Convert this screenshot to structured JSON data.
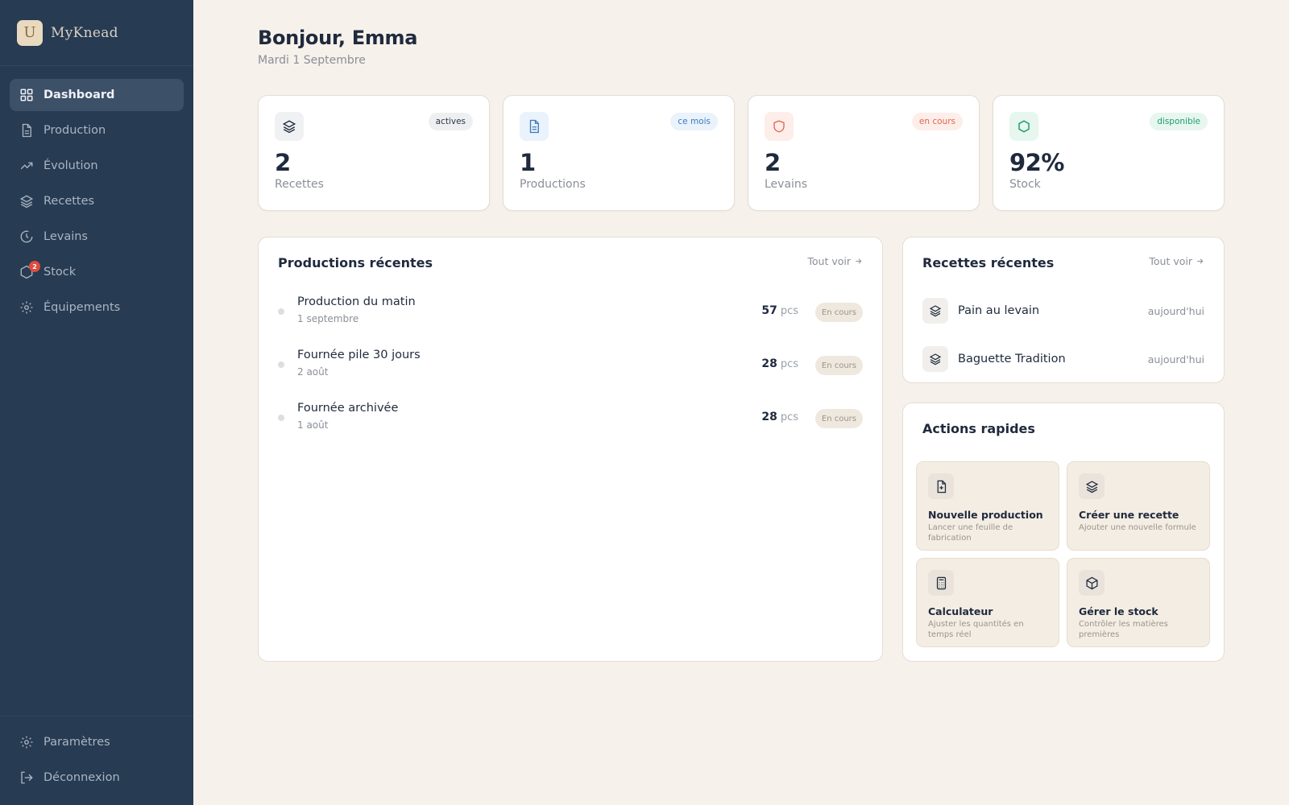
{
  "app": {
    "name": "MyKnead",
    "logo_letter": "U"
  },
  "sidebar": {
    "items": [
      {
        "label": "Dashboard",
        "icon": "grid-icon",
        "active": true
      },
      {
        "label": "Production",
        "icon": "document-icon"
      },
      {
        "label": "Évolution",
        "icon": "trending-up-icon"
      },
      {
        "label": "Recettes",
        "icon": "layers-icon"
      },
      {
        "label": "Levains",
        "icon": "clock-icon"
      },
      {
        "label": "Stock",
        "icon": "box-icon",
        "badge": "2"
      },
      {
        "label": "Équipements",
        "icon": "cog-icon"
      }
    ],
    "bottom": [
      {
        "label": "Paramètres",
        "icon": "settings-icon"
      },
      {
        "label": "Déconnexion",
        "icon": "logout-icon"
      }
    ]
  },
  "header": {
    "greeting": "Bonjour, Emma",
    "date": "Mardi 1 Septembre"
  },
  "stats": [
    {
      "value": "2",
      "label": "Recettes",
      "badge": "actives",
      "icon": "layers-icon",
      "color": "#1f2a3d"
    },
    {
      "value": "1",
      "label": "Productions",
      "badge": "ce mois",
      "icon": "document-icon",
      "color": "#3b7bbf"
    },
    {
      "value": "2",
      "label": "Levains",
      "badge": "en cours",
      "icon": "shield-icon",
      "color": "#e2664f"
    },
    {
      "value": "92%",
      "label": "Stock",
      "badge": "disponible",
      "icon": "hexagon-icon",
      "color": "#1e9e6a"
    }
  ],
  "productions": {
    "title": "Productions récentes",
    "see_all": "Tout voir",
    "rows": [
      {
        "name": "Production du matin",
        "date": "1 septembre",
        "qty": "57",
        "unit": "pcs",
        "status": "En cours"
      },
      {
        "name": "Fournée pile 30 jours",
        "date": "2 août",
        "qty": "28",
        "unit": "pcs",
        "status": "En cours"
      },
      {
        "name": "Fournée archivée",
        "date": "1 août",
        "qty": "28",
        "unit": "pcs",
        "status": "En cours"
      }
    ]
  },
  "recipes": {
    "title": "Recettes récentes",
    "see_all": "Tout voir",
    "rows": [
      {
        "name": "Pain au levain",
        "when": "aujourd'hui"
      },
      {
        "name": "Baguette Tradition",
        "when": "aujourd'hui"
      }
    ]
  },
  "actions": {
    "title": "Actions rapides",
    "items": [
      {
        "title": "Nouvelle production",
        "desc": "Lancer une feuille de fabrication",
        "icon": "file-plus-icon"
      },
      {
        "title": "Créer une recette",
        "desc": "Ajouter une nouvelle formule",
        "icon": "layers-icon"
      },
      {
        "title": "Calculateur",
        "desc": "Ajuster les quantités en temps réel",
        "icon": "calculator-icon"
      },
      {
        "title": "Gérer le stock",
        "desc": "Contrôler les matières premières",
        "icon": "package-icon"
      }
    ]
  }
}
